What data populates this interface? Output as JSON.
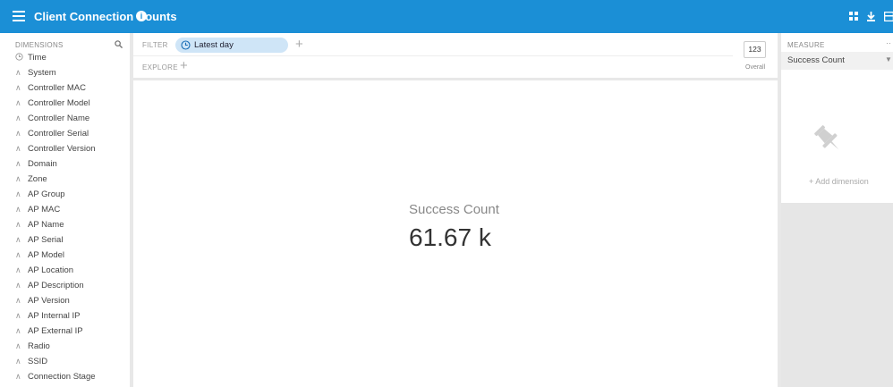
{
  "topbar": {
    "title": "Client Connection Counts",
    "icons": [
      "menu-icon",
      "info-icon",
      "grid-icon",
      "download-icon",
      "panel-icon"
    ],
    "color": "#1b8fd6"
  },
  "dimensions": {
    "header": "DIMENSIONS",
    "items": [
      {
        "label": "Time",
        "icon": "clock-icon"
      },
      {
        "label": "System",
        "icon": "string-icon"
      },
      {
        "label": "Controller MAC",
        "icon": "string-icon"
      },
      {
        "label": "Controller Model",
        "icon": "string-icon"
      },
      {
        "label": "Controller Name",
        "icon": "string-icon"
      },
      {
        "label": "Controller Serial",
        "icon": "string-icon"
      },
      {
        "label": "Controller Version",
        "icon": "string-icon"
      },
      {
        "label": "Domain",
        "icon": "string-icon"
      },
      {
        "label": "Zone",
        "icon": "string-icon"
      },
      {
        "label": "AP Group",
        "icon": "string-icon"
      },
      {
        "label": "AP MAC",
        "icon": "string-icon"
      },
      {
        "label": "AP Name",
        "icon": "string-icon"
      },
      {
        "label": "AP Serial",
        "icon": "string-icon"
      },
      {
        "label": "AP Model",
        "icon": "string-icon"
      },
      {
        "label": "AP Location",
        "icon": "string-icon"
      },
      {
        "label": "AP Description",
        "icon": "string-icon"
      },
      {
        "label": "AP Version",
        "icon": "string-icon"
      },
      {
        "label": "AP Internal IP",
        "icon": "string-icon"
      },
      {
        "label": "AP External IP",
        "icon": "string-icon"
      },
      {
        "label": "Radio",
        "icon": "string-icon"
      },
      {
        "label": "SSID",
        "icon": "string-icon"
      },
      {
        "label": "Connection Stage",
        "icon": "string-icon"
      }
    ]
  },
  "filter": {
    "label": "FILTER",
    "pill": "Latest day"
  },
  "explore": {
    "label": "EXPLORE"
  },
  "overall": {
    "box": "123",
    "label": "Overall"
  },
  "main": {
    "metric_name": "Success Count",
    "metric_value": "61.67 k"
  },
  "measure": {
    "header": "MEASURE",
    "dots": "··",
    "selected": "Success Count"
  },
  "pin": {
    "add_dimension": "+ Add dimension"
  }
}
